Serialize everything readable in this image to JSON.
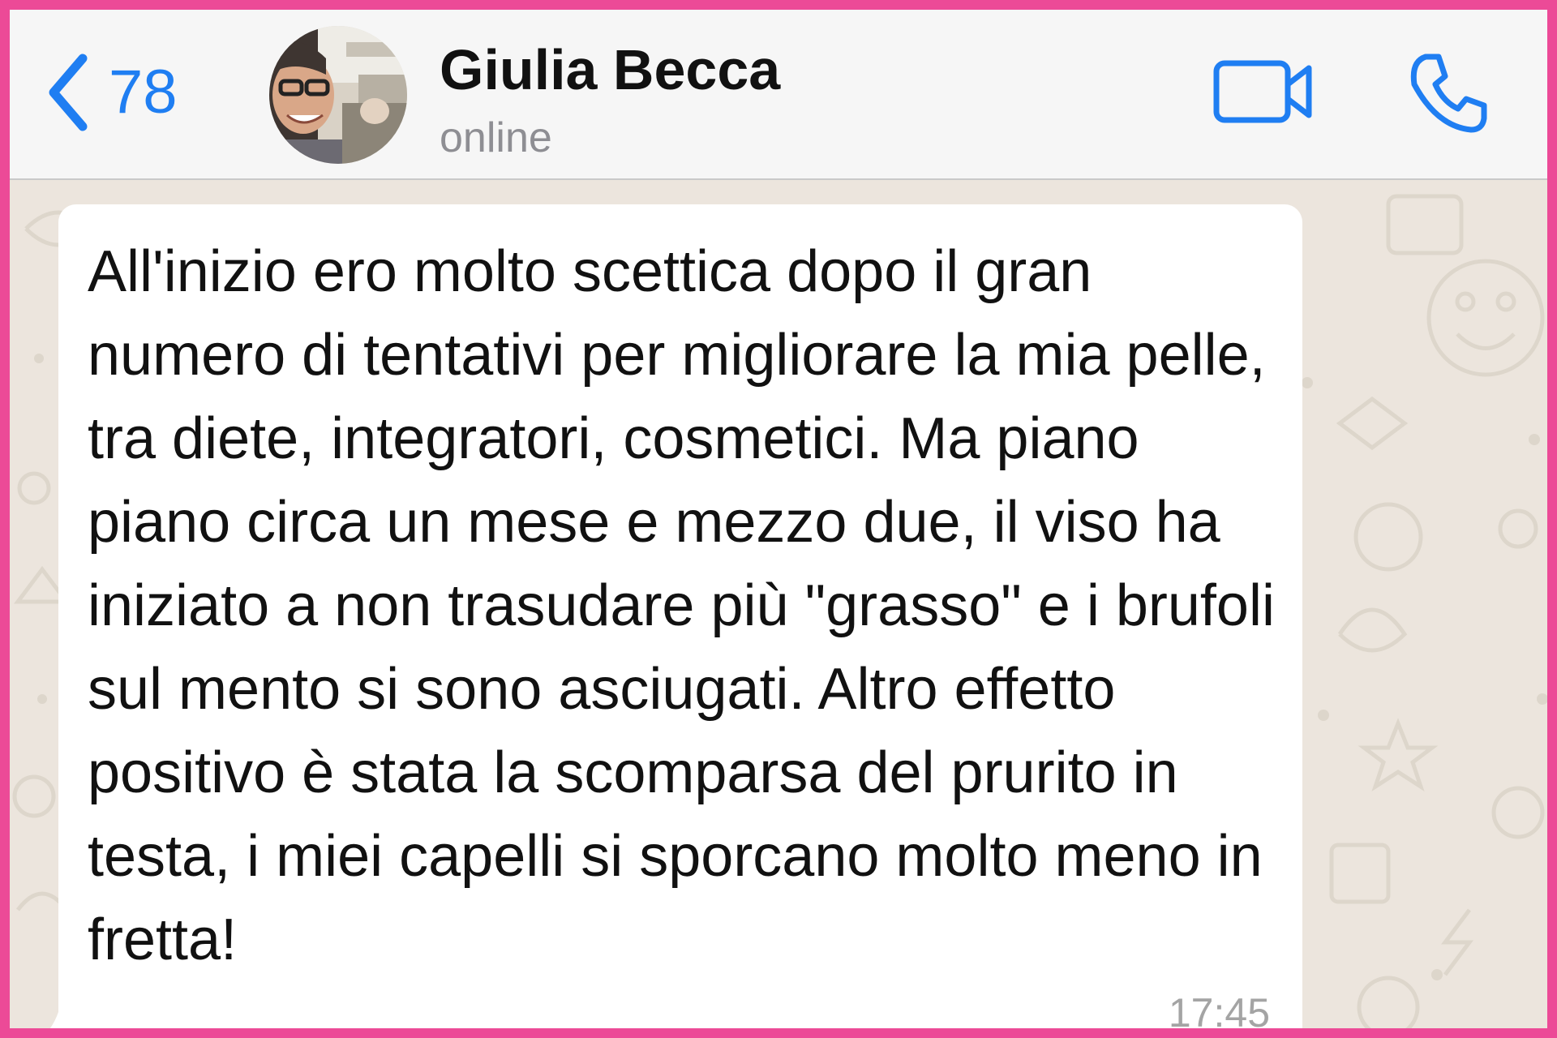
{
  "header": {
    "back_count": "78",
    "contact_name": "Giulia Becca",
    "status": "online"
  },
  "icons": {
    "back": "chevron-left-icon",
    "video": "video-camera-icon",
    "phone": "phone-icon",
    "avatar": "contact-avatar-photo"
  },
  "message": {
    "text": "All'inizio ero molto scettica dopo il gran numero di tentativi per migliorare la mia pelle, tra diete, integratori, cosmetici. Ma piano piano circa un mese e mezzo due, il viso ha iniziato a non trasudare più \"grasso\" e i brufoli sul mento si sono asciugati. Altro effetto positivo è stata la scomparsa del prurito in testa, i miei capelli si sporcano molto meno in fretta!",
    "time": "17:45"
  },
  "colors": {
    "accent": "#1f7ef2",
    "frame_border": "#ec4a97",
    "header_bg": "#f6f6f6",
    "chat_bg": "#ece5dd",
    "bubble_bg": "#ffffff",
    "time_text": "#a4a4a4",
    "status_text": "#8e8e93"
  }
}
